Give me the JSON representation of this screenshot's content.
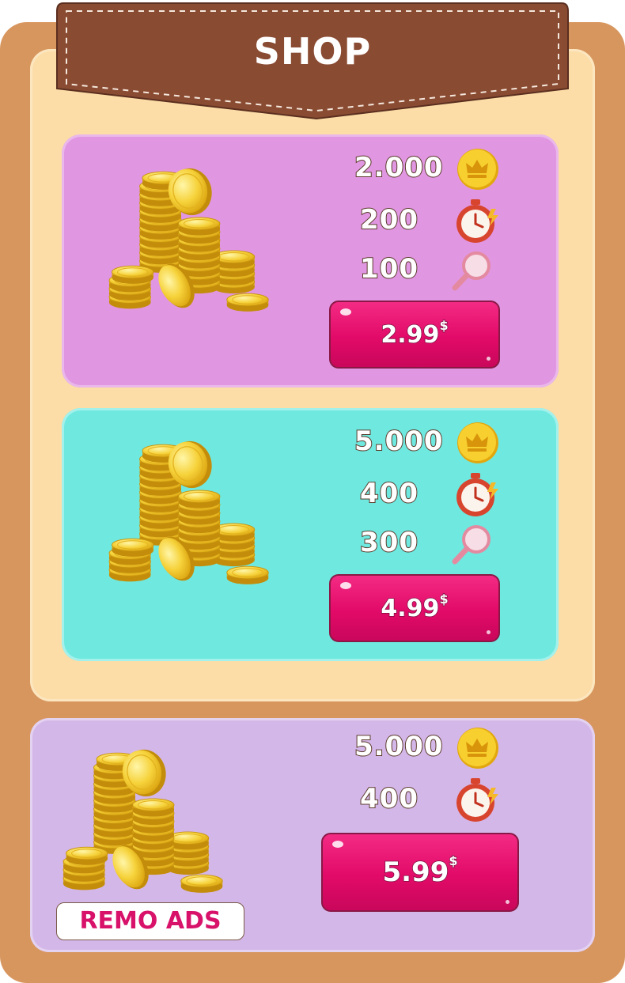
{
  "header": {
    "title": "SHOP"
  },
  "colors": {
    "frame": "#d8965f",
    "inner_panel": "#fcdda8",
    "banner": "#8a4b33",
    "card_pink": "#e196e2",
    "card_teal": "#6fe9e0",
    "card_lavender": "#d4b7e9",
    "price_button": "#e8116f"
  },
  "packs": [
    {
      "items": [
        {
          "value": "2.000",
          "icon": "gold-crown-coin-icon"
        },
        {
          "value": "200",
          "icon": "stopwatch-icon"
        },
        {
          "value": "100",
          "icon": "magnifier-icon"
        }
      ],
      "price": "2.99",
      "currency": "$"
    },
    {
      "items": [
        {
          "value": "5.000",
          "icon": "gold-crown-coin-icon"
        },
        {
          "value": "400",
          "icon": "stopwatch-icon"
        },
        {
          "value": "300",
          "icon": "magnifier-icon"
        }
      ],
      "price": "4.99",
      "currency": "$"
    },
    {
      "items": [
        {
          "value": "5.000",
          "icon": "gold-crown-coin-icon"
        },
        {
          "value": "400",
          "icon": "stopwatch-icon"
        }
      ],
      "price": "5.99",
      "currency": "$",
      "tag": "REMO ADS"
    }
  ]
}
